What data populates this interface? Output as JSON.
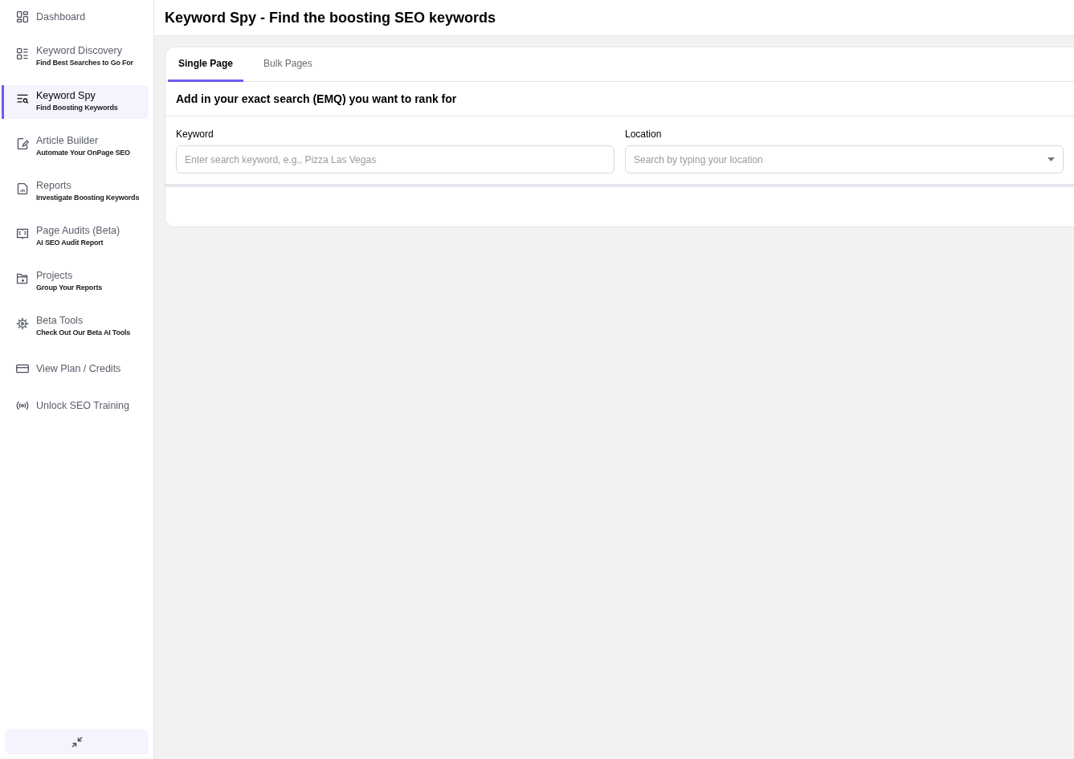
{
  "sidebar": {
    "items": [
      {
        "label": "Dashboard",
        "selected": false
      },
      {
        "label": "Keyword Discovery",
        "subtitle": "Find Best Searches to Go For",
        "selected": false
      },
      {
        "label": "Keyword Spy",
        "subtitle": "Find Boosting Keywords",
        "selected": true
      },
      {
        "label": "Article Builder",
        "subtitle": "Automate Your OnPage SEO",
        "selected": false
      },
      {
        "label": "Reports",
        "subtitle": "Investigate Boosting Keywords",
        "selected": false
      },
      {
        "label": "Page Audits (Beta)",
        "subtitle": "AI SEO Audit Report",
        "selected": false
      },
      {
        "label": "Projects",
        "subtitle": "Group Your Reports",
        "selected": false
      },
      {
        "label": "Beta Tools",
        "subtitle": "Check Out Our Beta AI Tools",
        "selected": false
      },
      {
        "label": "View Plan / Credits",
        "selected": false
      },
      {
        "label": "Unlock SEO Training",
        "selected": false
      }
    ]
  },
  "header": {
    "title": "Keyword Spy - Find the boosting SEO keywords"
  },
  "tabs": [
    {
      "label": "Single Page",
      "selected": true
    },
    {
      "label": "Bulk Pages",
      "selected": false
    }
  ],
  "form": {
    "heading": "Add in your exact search (EMQ) you want to rank for",
    "keyword": {
      "label": "Keyword",
      "placeholder": "Enter search keyword, e.g., Pizza Las Vegas"
    },
    "location": {
      "label": "Location",
      "placeholder": "Search by typing your location"
    }
  }
}
